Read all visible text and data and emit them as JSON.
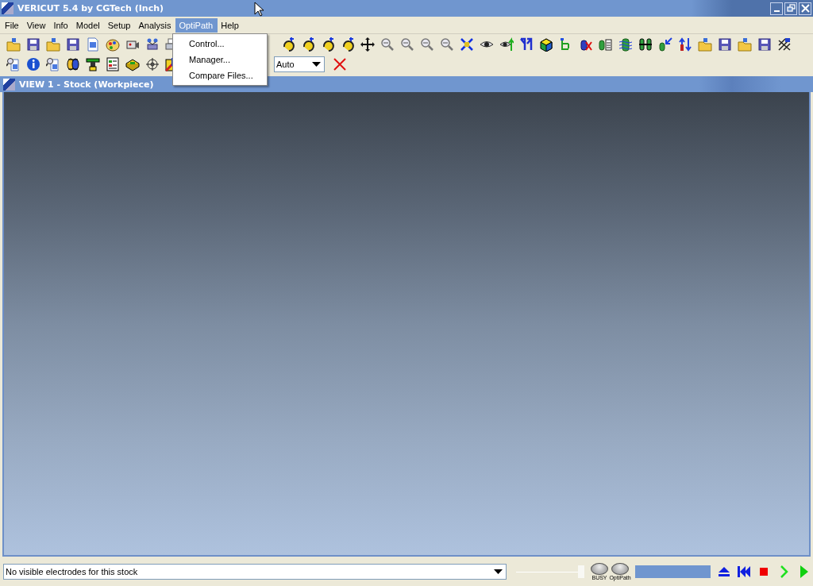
{
  "window": {
    "title": "VERICUT 5.4 by CGTech (Inch)"
  },
  "menu_bar": [
    {
      "label": "File",
      "selected": false
    },
    {
      "label": "View",
      "selected": false
    },
    {
      "label": "Info",
      "selected": false
    },
    {
      "label": "Model",
      "selected": false
    },
    {
      "label": "Setup",
      "selected": false
    },
    {
      "label": "Analysis",
      "selected": false
    },
    {
      "label": "OptiPath",
      "selected": true
    },
    {
      "label": "Help",
      "selected": false
    }
  ],
  "open_menu": {
    "items": [
      {
        "label": "Control..."
      },
      {
        "label": "Manager..."
      },
      {
        "label": "Compare Files..."
      }
    ]
  },
  "toolbar": {
    "display_mode": "Auto"
  },
  "view": {
    "title": "VIEW 1 - Stock (Workpiece)"
  },
  "status_bar": {
    "electrode_selector": "No visible electrodes for this stock",
    "slider": {
      "level": 1
    },
    "progress": {
      "level": 1
    },
    "indicators": [
      {
        "label": "BUSY"
      },
      {
        "label": "OptiPath"
      }
    ]
  }
}
